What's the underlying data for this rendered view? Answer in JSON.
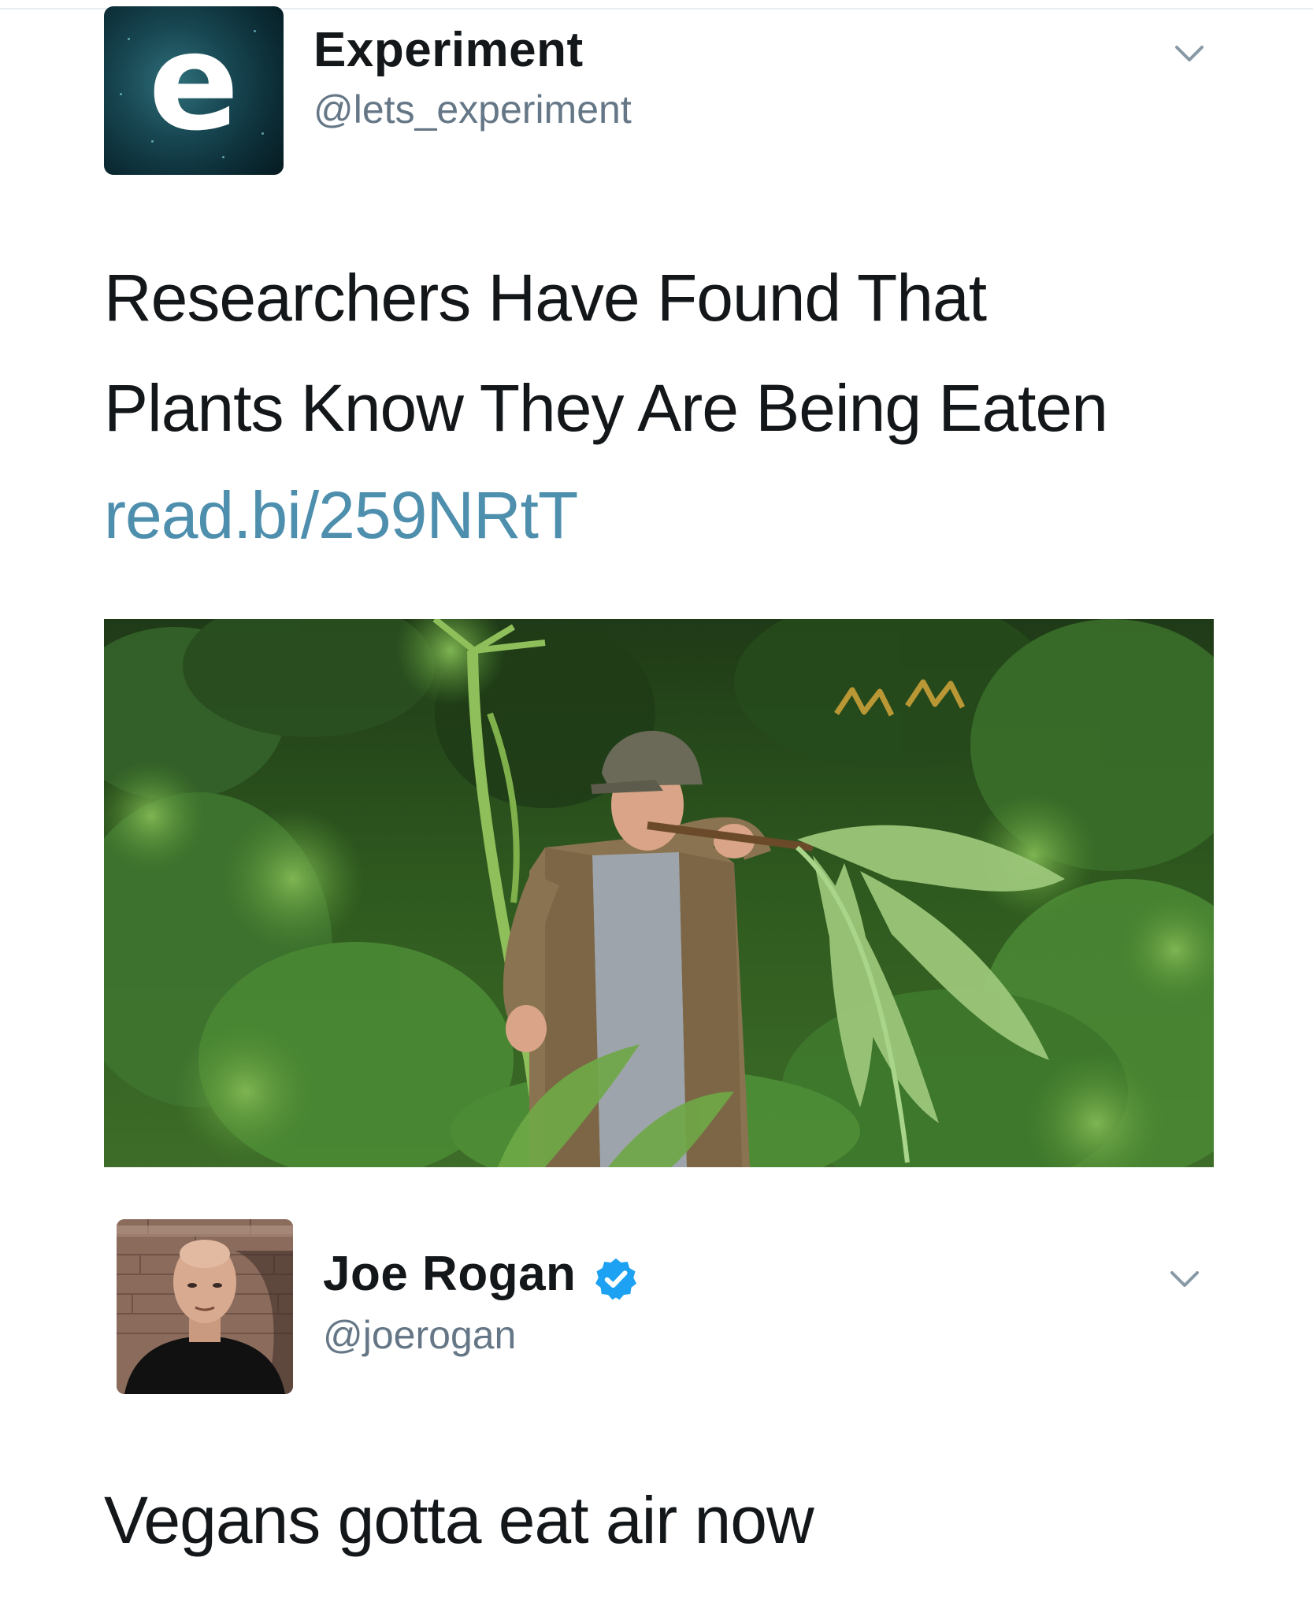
{
  "tweet1": {
    "display_name": "Experiment",
    "handle": "@lets_experiment",
    "avatar_letter": "e",
    "text_line1": "Researchers Have Found That",
    "text_line2": "Plants Know They Are Being Eaten",
    "link": "read.bi/259NRtT",
    "media_overlay_text": "m m"
  },
  "tweet2": {
    "display_name": "Joe Rogan",
    "handle": "@joerogan",
    "verified": true,
    "text": "Vegans gotta eat air now"
  },
  "colors": {
    "text": "#14171a",
    "handle": "#657786",
    "link": "#4e8fae",
    "verified_badge": "#1da1f2",
    "chevron": "#8899a6"
  },
  "icons": {
    "dropdown": "chevron-down-icon",
    "verified": "verified-badge-icon"
  }
}
